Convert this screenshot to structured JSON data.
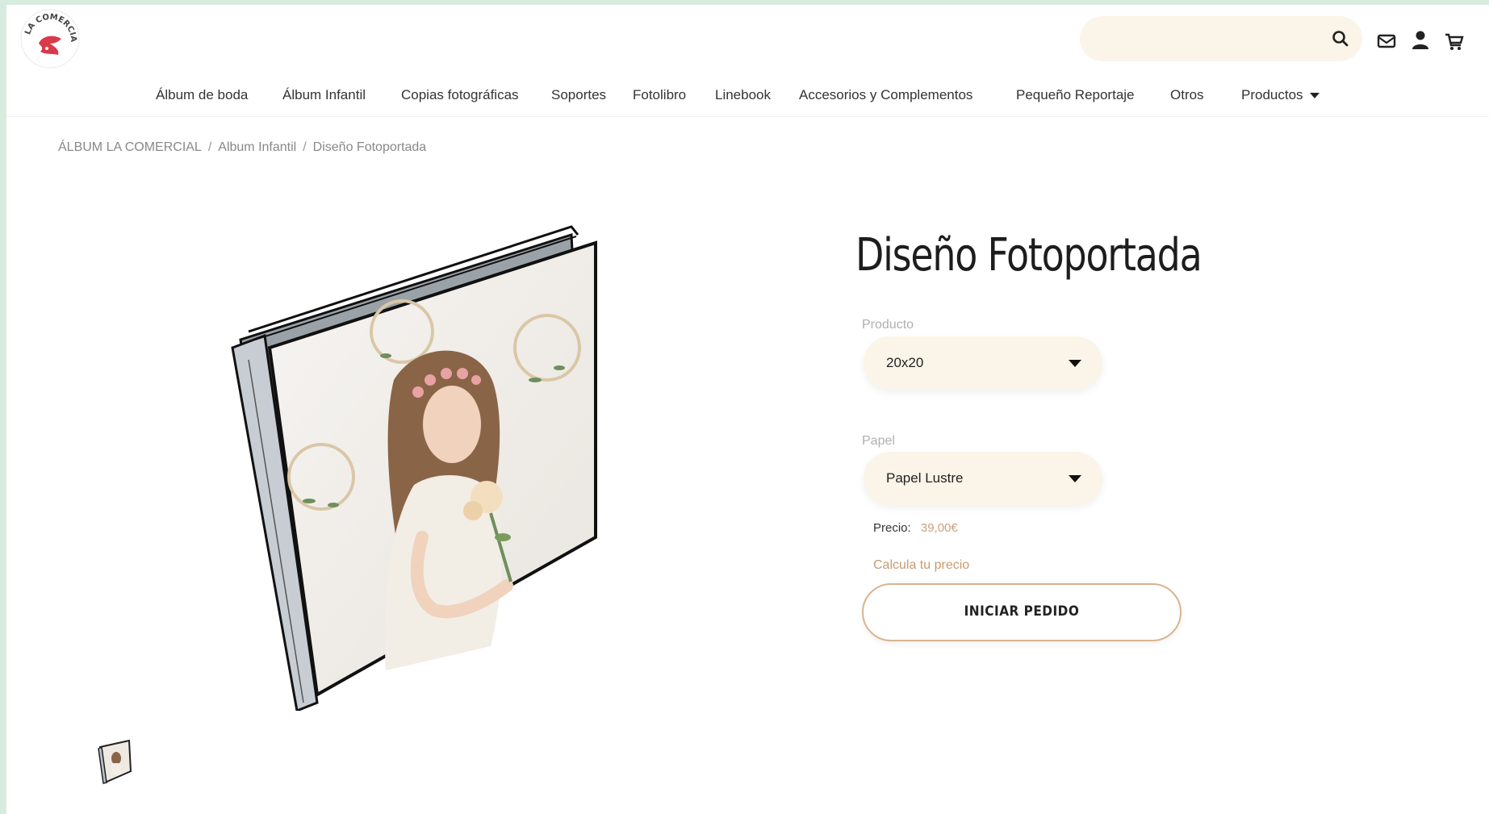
{
  "header": {
    "logo_text": "LA COMERCIAL",
    "search": {
      "value": "",
      "placeholder": ""
    },
    "icons": [
      "search-icon",
      "mail-icon",
      "user-icon",
      "cart-icon"
    ]
  },
  "nav": {
    "items": [
      "Álbum de boda",
      "Álbum Infantil",
      "Copias fotográficas",
      "Soportes",
      "Fotolibro",
      "Linebook",
      "Accesorios y Complementos",
      "Pequeño Reportaje",
      "Otros",
      "Productos"
    ]
  },
  "breadcrumb": {
    "items": [
      "ÁLBUM LA COMERCIAL",
      "Album Infantil",
      "Diseño Fotoportada"
    ],
    "separator": "/"
  },
  "product": {
    "title": "Diseño Fotoportada",
    "producto_label": "Producto",
    "producto_value": "20x20",
    "papel_label": "Papel",
    "papel_value": "Papel Lustre",
    "price_label": "Precio:",
    "price_value": "39,00€",
    "calc_link": "Calcula tu precio",
    "order_button": "INICIAR PEDIDO"
  },
  "colors": {
    "accent": "#d8b58f",
    "select_bg": "#fbf4e8",
    "frame": "#d7ecdf",
    "logo_red": "#d83a4a"
  }
}
